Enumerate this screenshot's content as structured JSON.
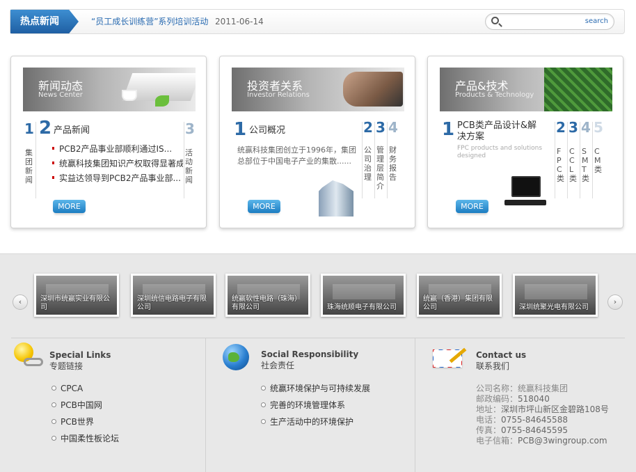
{
  "topbar": {
    "hot_label": "热点新闻",
    "news_headline": "“员工成长训练营”系列培训活动",
    "news_date": "2011-06-14",
    "search_placeholder": "",
    "search_button": "search"
  },
  "cards": [
    {
      "title_cn": "新闻动态",
      "title_en": "News Center",
      "tab1_num": "1",
      "tab1_label": "集团新闻",
      "tab2_num": "2",
      "tab2_label": "产品新闻",
      "tab3_num": "3",
      "tab3_label": "活动新闻",
      "items": [
        "PCB2产品事业部顺利通过IS...",
        "统赢科技集团知识产权取得显著成",
        "实益达领导到PCB2产品事业部..."
      ],
      "more": "MORE"
    },
    {
      "title_cn": "投资者关系",
      "title_en": "Investor Relations",
      "tab1_num": "1",
      "tab1_label": "公司概况",
      "description": "统赢科技集团创立于1996年，集团总部位于中国电子产业的集散......",
      "side_tabs": [
        {
          "num": "2",
          "label": "公司治理"
        },
        {
          "num": "3",
          "label": "管理层简介"
        },
        {
          "num": "4",
          "label": "财务报告"
        }
      ],
      "more": "MORE"
    },
    {
      "title_cn": "产品&技术",
      "title_en": "Products & Technology",
      "tab1_num": "1",
      "tab1_label": "PCB类产品设计&解决方案",
      "description_en": "FPC products and solutions designed",
      "side_tabs": [
        {
          "num": "2",
          "label": "FPC类"
        },
        {
          "num": "3",
          "label": "CCL类"
        },
        {
          "num": "4",
          "label": "SMT类"
        },
        {
          "num": "5",
          "label": "CM类"
        }
      ],
      "more": "MORE"
    }
  ],
  "carousel": {
    "prev": "‹",
    "next": "›",
    "items": [
      "深圳市统赢实业有限公司",
      "深圳统信电路电子有限公司",
      "统赢软性电路（珠海）有限公司",
      "珠海统顺电子有限公司",
      "统赢（香港）集团有限公司",
      "深圳统聚光电有限公司"
    ]
  },
  "special_links": {
    "title_en": "Special Links",
    "title_cn": "专题链接",
    "items": [
      "CPCA",
      "PCB中国网",
      "PCB世界",
      "中国柔性板论坛"
    ]
  },
  "social": {
    "title_en": "Social Responsibility",
    "title_cn": "社会责任",
    "items": [
      "统赢环境保护与可持续发展",
      "完善的环境管理体系",
      "生产活动中的环境保护"
    ]
  },
  "contact": {
    "title_en": "Contact us",
    "title_cn": "联系我们",
    "company_label": "公司名称：",
    "company": "统赢科技集团",
    "postcode_label": "邮政编码：",
    "postcode": "518040",
    "address_label": "地址：",
    "address": "深圳市坪山新区金碧路108号",
    "phone_label": "电话：",
    "phone": "0755-84645588",
    "fax_label": "传真：",
    "fax": "0755-84645595",
    "email_label": "电子信箱：",
    "email": "PCB@3wingroup.com"
  }
}
